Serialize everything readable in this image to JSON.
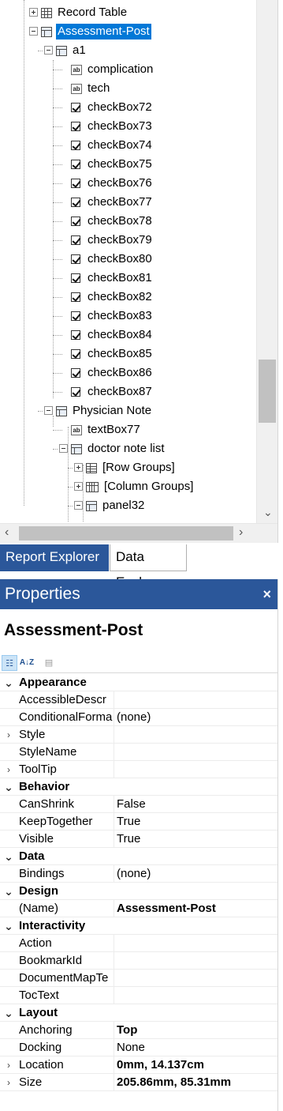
{
  "tree": {
    "items": [
      {
        "label": "Record Table",
        "icon": "table-icon",
        "expander": "plus"
      },
      {
        "label": "Assessment-Post",
        "icon": "panel-icon",
        "expander": "minus",
        "selected": true
      },
      {
        "label": "a1",
        "icon": "panel-icon",
        "expander": "minus"
      },
      {
        "label": "complication",
        "icon": "textbox-icon"
      },
      {
        "label": "tech",
        "icon": "textbox-icon"
      },
      {
        "label": "checkBox72",
        "icon": "checkbox-icon"
      },
      {
        "label": "checkBox73",
        "icon": "checkbox-icon"
      },
      {
        "label": "checkBox74",
        "icon": "checkbox-icon"
      },
      {
        "label": "checkBox75",
        "icon": "checkbox-icon"
      },
      {
        "label": "checkBox76",
        "icon": "checkbox-icon"
      },
      {
        "label": "checkBox77",
        "icon": "checkbox-icon"
      },
      {
        "label": "checkBox78",
        "icon": "checkbox-icon"
      },
      {
        "label": "checkBox79",
        "icon": "checkbox-icon"
      },
      {
        "label": "checkBox80",
        "icon": "checkbox-icon"
      },
      {
        "label": "checkBox81",
        "icon": "checkbox-icon"
      },
      {
        "label": "checkBox82",
        "icon": "checkbox-icon"
      },
      {
        "label": "checkBox83",
        "icon": "checkbox-icon"
      },
      {
        "label": "checkBox84",
        "icon": "checkbox-icon"
      },
      {
        "label": "checkBox85",
        "icon": "checkbox-icon"
      },
      {
        "label": "checkBox86",
        "icon": "checkbox-icon"
      },
      {
        "label": "checkBox87",
        "icon": "checkbox-icon"
      },
      {
        "label": "Physician Note",
        "icon": "panel-icon",
        "expander": "minus"
      },
      {
        "label": "textBox77",
        "icon": "textbox-icon"
      },
      {
        "label": "doctor note list",
        "icon": "panel-icon",
        "expander": "minus"
      },
      {
        "label": "[Row Groups]",
        "icon": "row-groups-icon",
        "expander": "plus"
      },
      {
        "label": "[Column Groups]",
        "icon": "column-groups-icon",
        "expander": "plus"
      },
      {
        "label": "panel32",
        "icon": "panel-icon",
        "expander": "minus"
      }
    ]
  },
  "scroll": {
    "up": "⌃",
    "down": "⌄",
    "left": "‹",
    "right": "›"
  },
  "tabs": {
    "report_explorer": "Report Explorer",
    "data_explorer": "Data Explorer"
  },
  "properties": {
    "header": "Properties",
    "close_glyph": "×",
    "selected_object": "Assessment-Post",
    "toolbar": {
      "categorized": "☷",
      "alphabetical": "A↓Z",
      "property_pages": "▤"
    },
    "rows": [
      {
        "kind": "category",
        "name": "Appearance"
      },
      {
        "kind": "prop",
        "name": "AccessibleDescr",
        "value": ""
      },
      {
        "kind": "prop",
        "name": "ConditionalForma",
        "value": "(none)"
      },
      {
        "kind": "prop",
        "name": "Style",
        "value": "",
        "expandable": true
      },
      {
        "kind": "prop",
        "name": "StyleName",
        "value": ""
      },
      {
        "kind": "prop",
        "name": "ToolTip",
        "value": "",
        "expandable": true
      },
      {
        "kind": "category",
        "name": "Behavior"
      },
      {
        "kind": "prop",
        "name": "CanShrink",
        "value": "False"
      },
      {
        "kind": "prop",
        "name": "KeepTogether",
        "value": "True"
      },
      {
        "kind": "prop",
        "name": "Visible",
        "value": "True"
      },
      {
        "kind": "category",
        "name": "Data"
      },
      {
        "kind": "prop",
        "name": "Bindings",
        "value": "(none)"
      },
      {
        "kind": "category",
        "name": "Design"
      },
      {
        "kind": "prop",
        "name": "(Name)",
        "value": "Assessment-Post",
        "bold": true
      },
      {
        "kind": "category",
        "name": "Interactivity"
      },
      {
        "kind": "prop",
        "name": "Action",
        "value": ""
      },
      {
        "kind": "prop",
        "name": "BookmarkId",
        "value": ""
      },
      {
        "kind": "prop",
        "name": "DocumentMapTe",
        "value": ""
      },
      {
        "kind": "prop",
        "name": "TocText",
        "value": ""
      },
      {
        "kind": "category",
        "name": "Layout"
      },
      {
        "kind": "prop",
        "name": "Anchoring",
        "value": "Top",
        "bold": true
      },
      {
        "kind": "prop",
        "name": "Docking",
        "value": "None"
      },
      {
        "kind": "prop",
        "name": "Location",
        "value": "0mm, 14.137cm",
        "bold": true,
        "expandable": true
      },
      {
        "kind": "prop",
        "name": "Size",
        "value": "205.86mm, 85.31mm",
        "bold": true,
        "expandable": true
      }
    ]
  },
  "colors": {
    "accent": "#2b579a",
    "selection": "#0078d7"
  }
}
